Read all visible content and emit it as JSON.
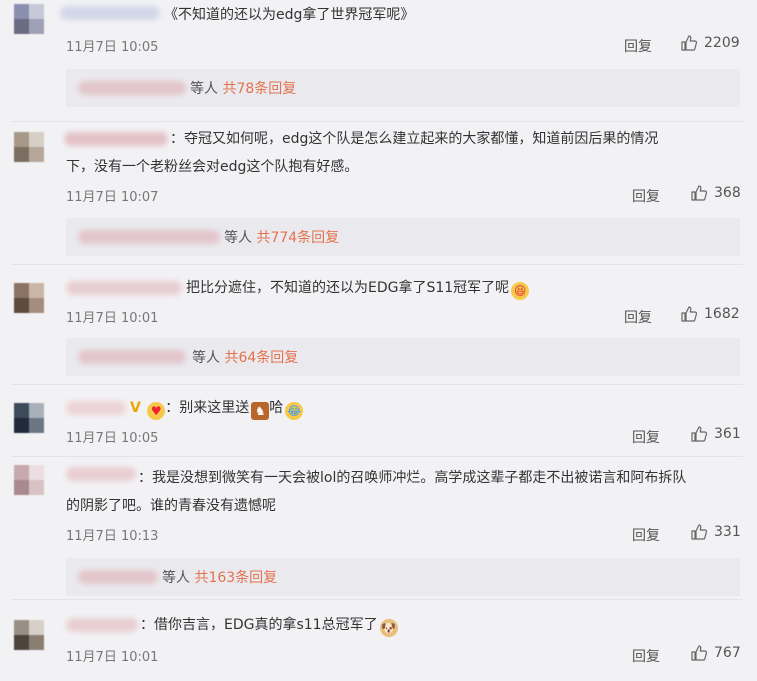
{
  "colors": {
    "background": "#f2f2f5",
    "subreply_background": "#eaeaee",
    "accent": "#e4724f",
    "text": "#333333",
    "meta": "#777777"
  },
  "comments": [
    {
      "name": "",
      "text": "《不知道的还以为edg拿了世界冠军呢》",
      "time": "11月7日 10:05",
      "reply_label": "回复",
      "likes": "2209",
      "emojis": [],
      "subreply": {
        "prefix": "等人",
        "count_text": "共78条回复"
      }
    },
    {
      "name": "",
      "text_line1": "：夺冠又如何呢，edg这个队是怎么建立起来的大家都懂，知道前因后果的情况",
      "text_line2": "下，没有一个老粉丝会对edg这个队抱有好感。",
      "time": "11月7日 10:07",
      "reply_label": "回复",
      "likes": "368",
      "emojis": [],
      "subreply": {
        "prefix": "等人",
        "count_text": "共774条回复"
      }
    },
    {
      "name": "",
      "text": "把比分遮住，不知道的还以为EDG拿了S11冠军了呢",
      "time": "11月7日 10:01",
      "reply_label": "回复",
      "likes": "1682",
      "emojis": [
        "laughing-emoji"
      ],
      "subreply": {
        "prefix": "等人",
        "count_text": "共64条回复"
      }
    },
    {
      "name": "",
      "badge": "V",
      "text_prefix": "：别来这里送",
      "text_suffix": "哈",
      "time": "11月7日 10:05",
      "reply_label": "回复",
      "likes": "361",
      "emojis": [
        "horse-emoji",
        "crying-laughing-emoji"
      ]
    },
    {
      "name": "",
      "text_line1": "：我是没想到微笑有一天会被lol的召唤师冲烂。高学成这辈子都走不出被诺言和阿布拆队",
      "text_line2": "的阴影了吧。谁的青春没有遗憾呢",
      "time": "11月7日 10:13",
      "reply_label": "回复",
      "likes": "331",
      "emojis": [],
      "subreply": {
        "prefix": "等人",
        "count_text": "共163条回复"
      }
    },
    {
      "name": "",
      "text": "：借你吉言，EDG真的拿s11总冠军了",
      "time": "11月7日 10:01",
      "reply_label": "回复",
      "likes": "767",
      "emojis": [
        "doge-emoji"
      ]
    }
  ]
}
